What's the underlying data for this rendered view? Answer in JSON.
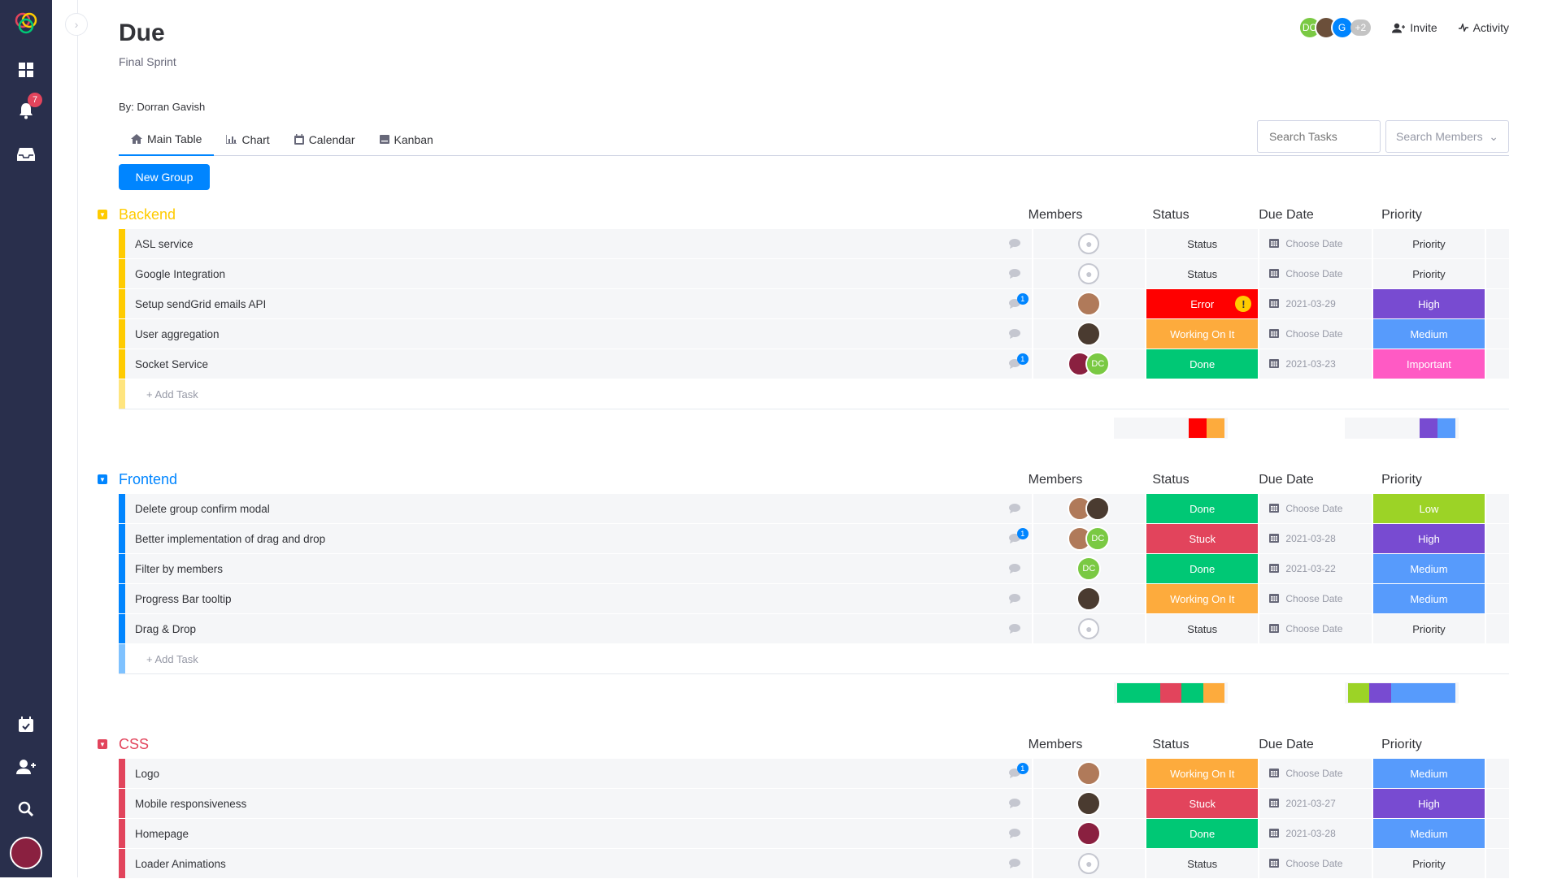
{
  "sidebar": {
    "notifications_count": "7"
  },
  "board": {
    "title": "Due",
    "subtitle": "Final Sprint",
    "by": "By: Dorran Gavish"
  },
  "header": {
    "members_more": "+2",
    "invite_label": "Invite",
    "activity_label": "Activity",
    "avatars": [
      {
        "initials": "DC",
        "color": "#7ac943"
      },
      {
        "initials": "",
        "color": "#6b4f3a"
      },
      {
        "initials": "G",
        "color": "#0085ff"
      }
    ]
  },
  "tabs": [
    {
      "label": "Main Table",
      "icon": "home-icon"
    },
    {
      "label": "Chart",
      "icon": "chart-icon"
    },
    {
      "label": "Calendar",
      "icon": "calendar-icon"
    },
    {
      "label": "Kanban",
      "icon": "kanban-icon"
    }
  ],
  "search": {
    "tasks_placeholder": "Search Tasks",
    "members_placeholder": "Search Members"
  },
  "new_group_label": "New Group",
  "columns": {
    "members": "Members",
    "status": "Status",
    "due_date": "Due Date",
    "priority": "Priority"
  },
  "add_task_label": "+ Add Task",
  "colors": {
    "error": "#ff0000",
    "working": "#fdab3d",
    "done": "#00c875",
    "stuck": "#e2445c",
    "high": "#784bd1",
    "medium": "#579bfc",
    "low": "#9cd326",
    "important": "#ff5ac4"
  },
  "groups": [
    {
      "title": "Backend",
      "color": "#ffcb00",
      "tasks": [
        {
          "name": "ASL service",
          "comments": "",
          "members": [],
          "status": "Status",
          "status_color": "",
          "date": "Choose Date",
          "priority": "Priority",
          "priority_color": ""
        },
        {
          "name": "Google Integration",
          "comments": "",
          "members": [],
          "status": "Status",
          "status_color": "",
          "date": "Choose Date",
          "priority": "Priority",
          "priority_color": ""
        },
        {
          "name": "Setup sendGrid emails API",
          "comments": "1",
          "members": [
            {
              "initials": "",
              "color": "#b07a5a"
            }
          ],
          "status": "Error",
          "status_color": "#ff0000",
          "warn": "!",
          "date": "2021-03-29",
          "priority": "High",
          "priority_color": "#784bd1"
        },
        {
          "name": "User aggregation",
          "comments": "",
          "members": [
            {
              "initials": "",
              "color": "#4a3b30"
            }
          ],
          "status": "Working On It",
          "status_color": "#fdab3d",
          "date": "Choose Date",
          "priority": "Medium",
          "priority_color": "#579bfc"
        },
        {
          "name": "Socket Service",
          "comments": "1",
          "members": [
            {
              "initials": "",
              "color": "#8a2040"
            },
            {
              "initials": "DC",
              "color": "#7ac943"
            }
          ],
          "status": "Done",
          "status_color": "#00c875",
          "date": "2021-03-23",
          "priority": "Important",
          "priority_color": "#ff5ac4"
        }
      ],
      "status_summary": [
        {
          "color": "#ff0000",
          "share": 0.5
        },
        {
          "color": "#fdab3d",
          "share": 0.5
        }
      ],
      "priority_summary": [
        {
          "color": "#784bd1",
          "share": 0.5
        },
        {
          "color": "#579bfc",
          "share": 0.5
        }
      ]
    },
    {
      "title": "Frontend",
      "color": "#0085ff",
      "tasks": [
        {
          "name": "Delete group confirm modal",
          "comments": "",
          "members": [
            {
              "initials": "",
              "color": "#b07a5a"
            },
            {
              "initials": "",
              "color": "#4a3b30"
            }
          ],
          "status": "Done",
          "status_color": "#00c875",
          "date": "Choose Date",
          "priority": "Low",
          "priority_color": "#9cd326"
        },
        {
          "name": "Better implementation of drag and drop",
          "comments": "1",
          "members": [
            {
              "initials": "",
              "color": "#b07a5a"
            },
            {
              "initials": "DC",
              "color": "#7ac943"
            }
          ],
          "status": "Stuck",
          "status_color": "#e2445c",
          "date": "2021-03-28",
          "priority": "High",
          "priority_color": "#784bd1"
        },
        {
          "name": "Filter by members",
          "comments": "",
          "members": [
            {
              "initials": "DC",
              "color": "#7ac943"
            }
          ],
          "status": "Done",
          "status_color": "#00c875",
          "date": "2021-03-22",
          "priority": "Medium",
          "priority_color": "#579bfc"
        },
        {
          "name": "Progress Bar tooltip",
          "comments": "",
          "members": [
            {
              "initials": "",
              "color": "#4a3b30"
            }
          ],
          "status": "Working On It",
          "status_color": "#fdab3d",
          "date": "Choose Date",
          "priority": "Medium",
          "priority_color": "#579bfc"
        },
        {
          "name": "Drag & Drop",
          "comments": "",
          "members": [],
          "status": "Status",
          "status_color": "",
          "date": "Choose Date",
          "priority": "Priority",
          "priority_color": ""
        }
      ],
      "status_summary": [
        {
          "color": "#00c875",
          "share": 0.4
        },
        {
          "color": "#e2445c",
          "share": 0.2
        },
        {
          "color": "#00c875",
          "share": 0.2
        },
        {
          "color": "#fdab3d",
          "share": 0.2
        }
      ],
      "priority_summary": [
        {
          "color": "#9cd326",
          "share": 0.2
        },
        {
          "color": "#784bd1",
          "share": 0.2
        },
        {
          "color": "#579bfc",
          "share": 0.6
        }
      ]
    },
    {
      "title": "CSS",
      "color": "#e2445c",
      "tasks": [
        {
          "name": "Logo",
          "comments": "1",
          "members": [
            {
              "initials": "",
              "color": "#b07a5a"
            }
          ],
          "status": "Working On It",
          "status_color": "#fdab3d",
          "date": "Choose Date",
          "priority": "Medium",
          "priority_color": "#579bfc"
        },
        {
          "name": "Mobile responsiveness",
          "comments": "",
          "members": [
            {
              "initials": "",
              "color": "#4a3b30"
            }
          ],
          "status": "Stuck",
          "status_color": "#e2445c",
          "date": "2021-03-27",
          "priority": "High",
          "priority_color": "#784bd1"
        },
        {
          "name": "Homepage",
          "comments": "",
          "members": [
            {
              "initials": "",
              "color": "#8a2040"
            }
          ],
          "status": "Done",
          "status_color": "#00c875",
          "date": "2021-03-28",
          "priority": "Medium",
          "priority_color": "#579bfc"
        },
        {
          "name": "Loader Animations",
          "comments": "",
          "members": [],
          "status": "Status",
          "status_color": "",
          "date": "Choose Date",
          "priority": "Priority",
          "priority_color": ""
        }
      ]
    }
  ]
}
